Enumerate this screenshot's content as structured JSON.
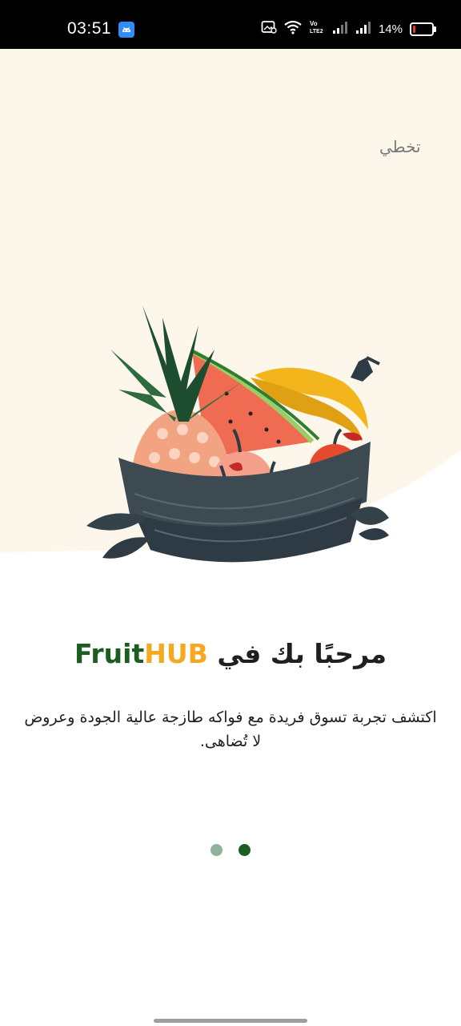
{
  "status_bar": {
    "time": "03:51",
    "battery_percent": "14%",
    "battery_level": 0.14,
    "icons": [
      "android-app-icon",
      "gallery-notification-icon",
      "wifi-icon",
      "volte-icon",
      "signal-icon",
      "signal-icon",
      "battery-icon"
    ]
  },
  "onboarding": {
    "skip_label": "تخطي",
    "title_text": "مرحبًا بك في",
    "brand_fruit": "Fruit",
    "brand_hub": "HUB",
    "description": "اكتشف تجربة تسوق فريدة مع فواكه طازجة عالية الجودة وعروض لا تُضاهى.",
    "illustration": "fruit-basket-illustration",
    "page_indicator": {
      "count": 2,
      "active_index": 1,
      "active_color": "#1b5e20",
      "inactive_color": "#8fb39a"
    }
  },
  "colors": {
    "hero_background": "#fdf6ea",
    "brand_green": "#1b5e20",
    "brand_orange": "#f4a91f"
  }
}
